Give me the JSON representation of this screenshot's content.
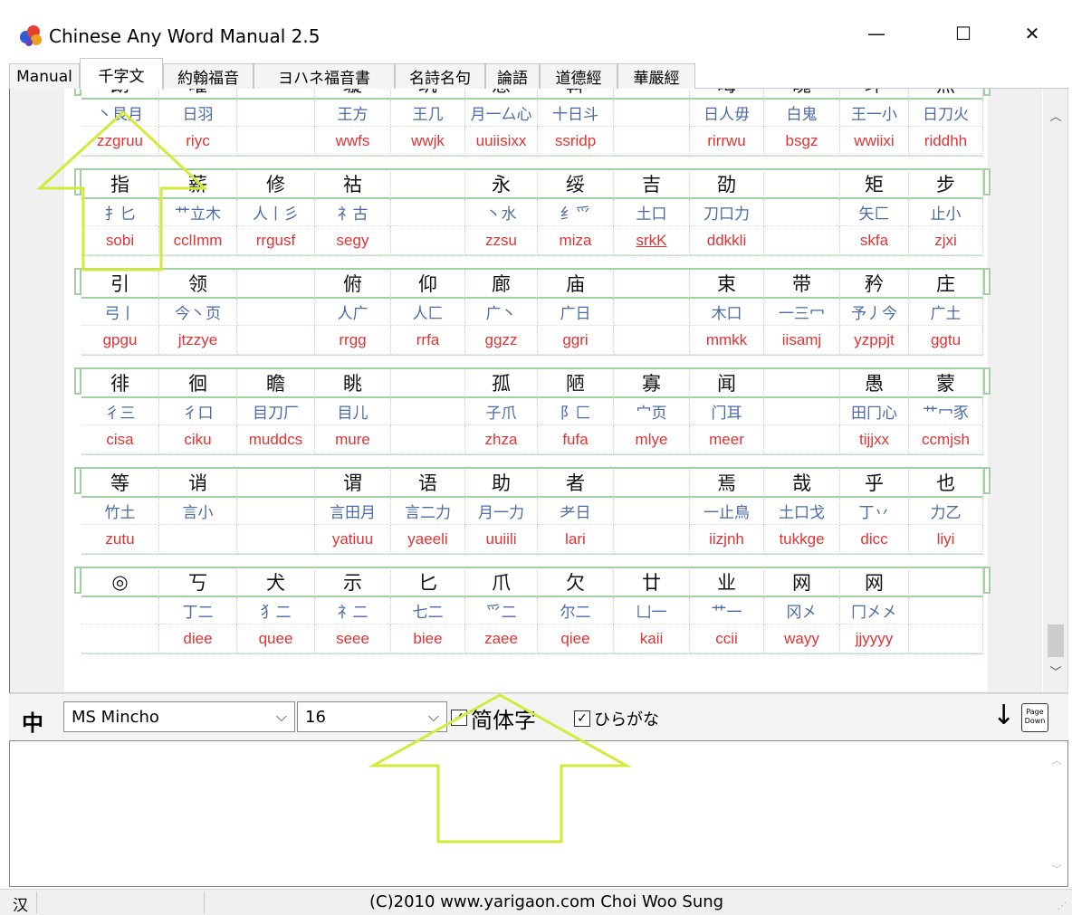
{
  "window": {
    "title": "Chinese Any Word Manual 2.5",
    "minimize_glyph": "—",
    "maximize_glyph": "☐",
    "close_glyph": "✕"
  },
  "tabs": [
    {
      "label": "Manual",
      "active": false
    },
    {
      "label": "千字文",
      "active": true
    },
    {
      "label": "約翰福音",
      "active": false
    },
    {
      "label": "ヨハネ福音書",
      "active": false
    },
    {
      "label": "名詩名句",
      "active": false
    },
    {
      "label": "論語",
      "active": false
    },
    {
      "label": "道德經",
      "active": false
    },
    {
      "label": "華嚴經",
      "active": false
    }
  ],
  "blocks": [
    {
      "chars": [
        "朗",
        "曜",
        "",
        "璇",
        "玑",
        "悬",
        "斡",
        "",
        "晦",
        "魄",
        "环",
        "照"
      ],
      "radicals": [
        "丶艮月",
        "日羽",
        "",
        "王方",
        "王几",
        "月一厶心",
        "十日斗",
        "",
        "日人毋",
        "白鬼",
        "王一小",
        "日刀火"
      ],
      "codes": [
        "zzgruu",
        "riyc",
        "",
        "wwfs",
        "wwjk",
        "uuiisixx",
        "ssridp",
        "",
        "rirrwu",
        "bsgz",
        "wwiixi",
        "riddhh"
      ]
    },
    {
      "chars": [
        "指",
        "薪",
        "修",
        "祜",
        "",
        "永",
        "绥",
        "吉",
        "劭",
        "",
        "矩",
        "步"
      ],
      "radicals": [
        "扌匕",
        "艹立木",
        "人丨彡",
        "礻古",
        "",
        "丶水",
        "纟爫",
        "土口",
        "刀口力",
        "",
        "矢匚",
        "止小"
      ],
      "codes": [
        "sobi",
        "cclImm",
        "rrgusf",
        "segy",
        "",
        "zzsu",
        "miza",
        "srkK",
        "ddkkli",
        "",
        "skfa",
        "zjxi"
      ]
    },
    {
      "chars": [
        "引",
        "领",
        "",
        "俯",
        "仰",
        "廊",
        "庙",
        "",
        "束",
        "带",
        "矜",
        "庄"
      ],
      "radicals": [
        "弓丨",
        "今丶页",
        "",
        "人广",
        "人匚",
        "广丶",
        "广日",
        "",
        "木口",
        "一三冖",
        "予丿今",
        "广土"
      ],
      "codes": [
        "gpgu",
        "jtzzye",
        "",
        "rrgg",
        "rrfa",
        "ggzz",
        "ggri",
        "",
        "mmkk",
        "iisamj",
        "yzppjt",
        "ggtu"
      ]
    },
    {
      "chars": [
        "徘",
        "徊",
        "瞻",
        "眺",
        "",
        "孤",
        "陋",
        "寡",
        "闻",
        "",
        "愚",
        "蒙"
      ],
      "radicals": [
        "彳三",
        "彳口",
        "目刀厂",
        "目儿",
        "",
        "子爪",
        "阝匚",
        "宀页",
        "门耳",
        "",
        "田冂心",
        "艹冖豕"
      ],
      "codes": [
        "cisa",
        "ciku",
        "muddcs",
        "mure",
        "",
        "zhza",
        "fufa",
        "mlye",
        "meer",
        "",
        "tijjxx",
        "ccmjsh"
      ]
    },
    {
      "chars": [
        "等",
        "诮",
        "",
        "谓",
        "语",
        "助",
        "者",
        "",
        "焉",
        "哉",
        "乎",
        "也"
      ],
      "radicals": [
        "竹土",
        "言小",
        "",
        "言田月",
        "言二力",
        "月一力",
        "耂日",
        "",
        "一止鳥",
        "土口戈",
        "丁丷",
        "力乙"
      ],
      "codes": [
        "zutu",
        "",
        "",
        "yatiuu",
        "yaeeli",
        "uuiili",
        "lari",
        "",
        "iizjnh",
        "tukkge",
        "dicc",
        "liyi"
      ]
    },
    {
      "chars": [
        "◎",
        "丂",
        "犬",
        "示",
        "匕",
        "爪",
        "欠",
        "廿",
        "业",
        "网",
        "网",
        ""
      ],
      "radicals": [
        "",
        "丁二",
        "犭二",
        "礻二",
        "七二",
        "爫二",
        "尔二",
        "凵一",
        "艹一",
        "冈㐅",
        "冂㐅㐅",
        ""
      ],
      "codes": [
        "",
        "diee",
        "quee",
        "seee",
        "biee",
        "zaee",
        "qiee",
        "kaii",
        "ccii",
        "wayy",
        "jjyyyy",
        ""
      ]
    }
  ],
  "toolbar": {
    "zhong_label": "中",
    "font_value": "MS Mincho",
    "size_value": "16",
    "dropdown_glyph": "⌵",
    "simplified_label": "简体字",
    "simplified_checked": true,
    "hiragana_label": "ひらがな",
    "hiragana_checked": true,
    "check_glyph": "✓",
    "down_arrow_glyph": "↓",
    "page_down_label_1": "Page",
    "page_down_label_2": "Down"
  },
  "scroll_glyphs": {
    "up": "︿",
    "down": "﹀"
  },
  "status": {
    "han": "汉",
    "copyright": "(C)2010 www.yarigaon.com Choi Woo Sung",
    "grip_glyph": "⋰"
  },
  "colors": {
    "char_text": "#111111",
    "radical_text": "#4a6aa8",
    "code_text": "#e23333",
    "grid_green": "#a3cfa3",
    "annotation_yellow": "#d3ea3a"
  }
}
